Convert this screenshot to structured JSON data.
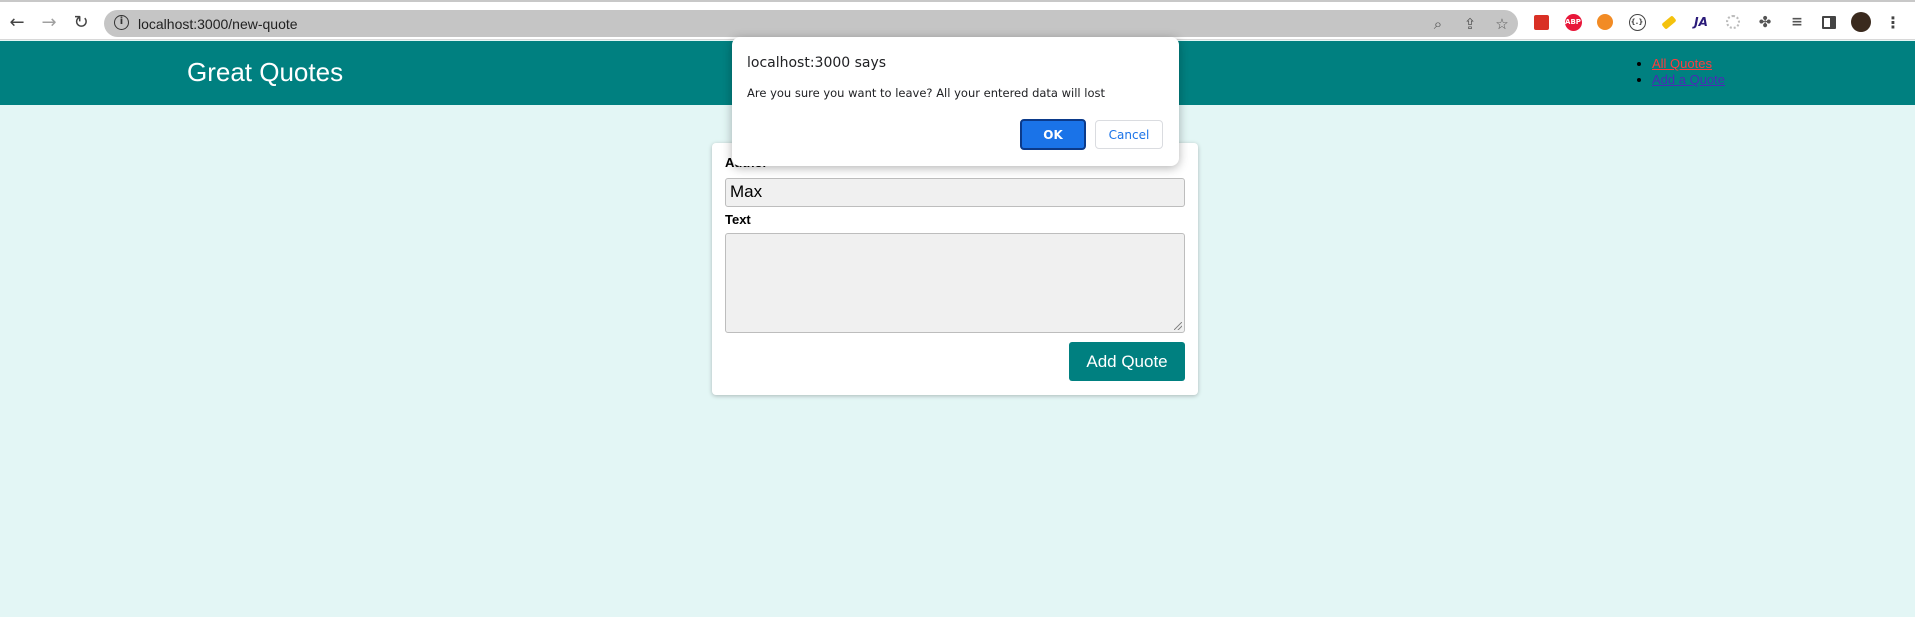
{
  "browser": {
    "url": "localhost:3000/new-quote",
    "icons": {
      "back": "arrow-left-icon",
      "forward": "arrow-right-icon",
      "reload": "reload-icon",
      "site_info": "info-icon",
      "zoom": "zoom-icon",
      "share": "share-icon",
      "bookmark": "star-icon",
      "extensions": "puzzle-icon",
      "reading_list": "reading-list-icon",
      "side_panel": "side-panel-icon",
      "menu": "kebab-menu-icon"
    },
    "extensions": [
      {
        "name": "extension-red-icon",
        "text": "",
        "color": "#d93025"
      },
      {
        "name": "adblock-plus-icon",
        "text": "ABP",
        "color": "#e8173a"
      },
      {
        "name": "extension-orange-icon",
        "text": "",
        "color": "#f28b24"
      },
      {
        "name": "extension-code-icon",
        "text": "{.}",
        "color": "#444444"
      },
      {
        "name": "highlighter-icon",
        "text": "",
        "color": "#f4c20d"
      },
      {
        "name": "extension-ja-icon",
        "text": "JA",
        "color": "#2b1b7a"
      },
      {
        "name": "extension-gray-icon",
        "text": "",
        "color": "#bbbbbb"
      }
    ]
  },
  "header": {
    "title": "Great Quotes",
    "nav": [
      {
        "label": "All Quotes",
        "active": true
      },
      {
        "label": "Add a Quote",
        "active": false
      }
    ]
  },
  "form": {
    "author_label": "Author",
    "author_value": "Max",
    "text_label": "Text",
    "text_value": "",
    "submit_label": "Add Quote"
  },
  "dialog": {
    "title": "localhost:3000 says",
    "message": "Are you sure you want to leave? All your entered data will lost",
    "ok_label": "OK",
    "cancel_label": "Cancel"
  },
  "colors": {
    "brand": "#008080",
    "page_background": "#e3f6f5",
    "dialog_primary": "#1a73e8"
  }
}
